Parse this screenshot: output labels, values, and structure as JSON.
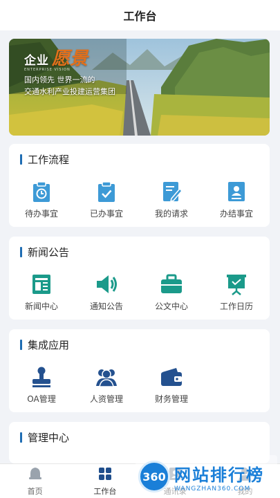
{
  "header": {
    "title": "工作台"
  },
  "banner": {
    "title_a": "企业",
    "title_b": "愿景",
    "subtitle": "ENTERPRISE VISION",
    "line1": "国内领先 世界一流的",
    "line2": "交通水利产业投建运营集团"
  },
  "sections": [
    {
      "title": "工作流程",
      "items": [
        {
          "label": "待办事宜",
          "icon": "clipboard-clock-icon"
        },
        {
          "label": "已办事宜",
          "icon": "clipboard-check-icon"
        },
        {
          "label": "我的请求",
          "icon": "document-pen-icon"
        },
        {
          "label": "办结事宜",
          "icon": "id-card-icon"
        }
      ]
    },
    {
      "title": "新闻公告",
      "items": [
        {
          "label": "新闻中心",
          "icon": "newspaper-icon"
        },
        {
          "label": "通知公告",
          "icon": "speaker-icon"
        },
        {
          "label": "公文中心",
          "icon": "briefcase-icon"
        },
        {
          "label": "工作日历",
          "icon": "presentation-board-icon"
        }
      ]
    },
    {
      "title": "集成应用",
      "items": [
        {
          "label": "OA管理",
          "icon": "stamp-icon"
        },
        {
          "label": "人资管理",
          "icon": "people-icon"
        },
        {
          "label": "财务管理",
          "icon": "wallet-icon"
        }
      ]
    },
    {
      "title": "管理中心",
      "items": []
    }
  ],
  "tabbar": [
    {
      "label": "首页",
      "icon": "bell-home-icon"
    },
    {
      "label": "工作台",
      "icon": "grid-icon",
      "active": true
    },
    {
      "label": "通讯录",
      "icon": "contacts-icon"
    },
    {
      "label": "我的",
      "icon": "person-icon"
    }
  ],
  "watermark": {
    "logo": "360",
    "text": "网站排行榜",
    "url": "WANGZHAN360.COM"
  },
  "colors": {
    "accent": "#1f6db3",
    "workflow_icon": "#3d9ad6",
    "news_icon": "#1b9a8a",
    "integration_icon": "#24518f"
  }
}
